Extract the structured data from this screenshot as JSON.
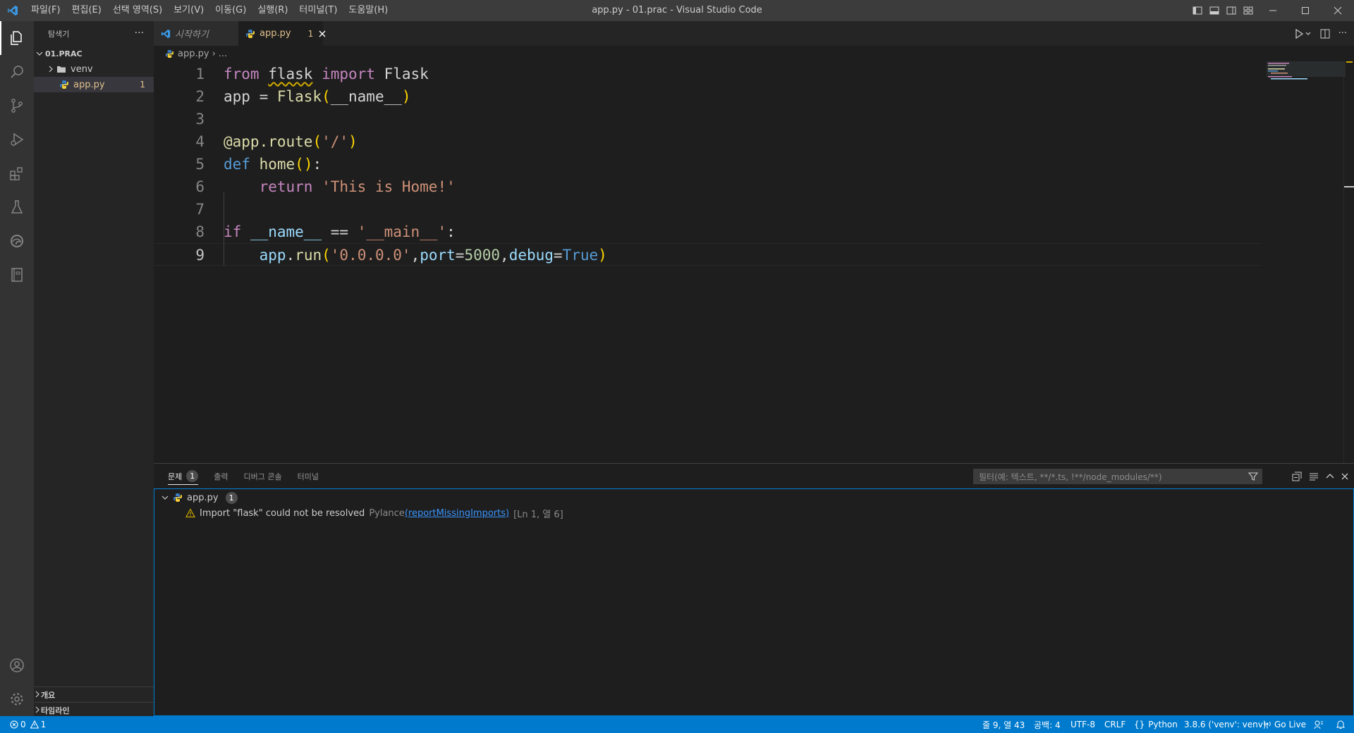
{
  "titlebar": {
    "menu": [
      "파일(F)",
      "편집(E)",
      "선택 영역(S)",
      "보기(V)",
      "이동(G)",
      "실행(R)",
      "터미널(T)",
      "도움말(H)"
    ],
    "window_title": "app.py - 01.prac - Visual Studio Code"
  },
  "activity_bar": [
    "explorer-icon",
    "search-icon",
    "source-control-icon",
    "run-debug-icon",
    "extensions-icon",
    "testing-icon",
    "edge-devtools-icon",
    "notebook-icon",
    "account-icon",
    "settings-gear-icon"
  ],
  "sidebar": {
    "title": "탐색기",
    "more": "···",
    "folder": "01.PRAC",
    "items": [
      {
        "label": "venv",
        "type": "folder"
      },
      {
        "label": "app.py",
        "type": "file",
        "badge": "1"
      }
    ],
    "outline": "개요",
    "timeline": "타임라인"
  },
  "tabs": [
    {
      "label": "시작하기",
      "active": false
    },
    {
      "label": "app.py",
      "badge": "1",
      "active": true
    }
  ],
  "breadcrumb": {
    "file": "app.py",
    "sep": "›",
    "rest": "..."
  },
  "editor": {
    "line_numbers": [
      "1",
      "2",
      "3",
      "4",
      "5",
      "6",
      "7",
      "8",
      "9"
    ],
    "cursor_line": 9
  },
  "panel": {
    "tabs": [
      {
        "label": "문제",
        "badge": "1",
        "active": true
      },
      {
        "label": "출력"
      },
      {
        "label": "디버그 콘솔"
      },
      {
        "label": "터미널"
      }
    ],
    "filter_placeholder": "필터(예: 텍스트, **/*.ts, !**/node_modules/**)",
    "problem_file": "app.py",
    "problem_count": "1",
    "problem": {
      "message": "Import \"flask\" could not be resolved",
      "source": "Pylance",
      "code": "(reportMissingImports)",
      "location": "[Ln 1, 열 6]"
    }
  },
  "statusbar": {
    "errors": "0",
    "warnings": "1",
    "position": "줄 9, 열 43",
    "spaces": "공백: 4",
    "encoding": "UTF-8",
    "eol": "CRLF",
    "language": "Python",
    "interpreter": "3.8.6 ('venv': venv)",
    "golive": "Go Live"
  },
  "colors": {
    "accent": "#007acc",
    "warning": "#cca700",
    "modified": "#e2c08d"
  }
}
